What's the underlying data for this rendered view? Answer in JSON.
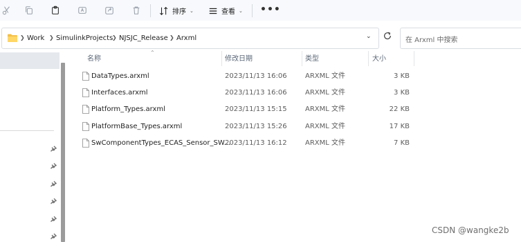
{
  "toolbar": {
    "sort_label": "排序",
    "view_label": "查看",
    "more_label": "•••"
  },
  "address": {
    "crumbs": [
      "Work",
      "SimulinkProjects",
      "NJSJC_Release",
      "Arxml"
    ],
    "search_placeholder": "在 Arxml 中搜索"
  },
  "columns": {
    "name": "名称",
    "date": "修改日期",
    "type": "类型",
    "size": "大小"
  },
  "files": [
    {
      "name": "DataTypes.arxml",
      "date": "2023/11/13 16:06",
      "type": "ARXML 文件",
      "size": "3 KB"
    },
    {
      "name": "Interfaces.arxml",
      "date": "2023/11/13 16:06",
      "type": "ARXML 文件",
      "size": "3 KB"
    },
    {
      "name": "Platform_Types.arxml",
      "date": "2023/11/13 15:15",
      "type": "ARXML 文件",
      "size": "22 KB"
    },
    {
      "name": "PlatformBase_Types.arxml",
      "date": "2023/11/13 15:26",
      "type": "ARXML 文件",
      "size": "17 KB"
    },
    {
      "name": "SwComponentTypes_ECAS_Sensor_SW...",
      "date": "2023/11/13 16:12",
      "type": "ARXML 文件",
      "size": "7 KB"
    }
  ],
  "watermark": "CSDN @wangke2b"
}
